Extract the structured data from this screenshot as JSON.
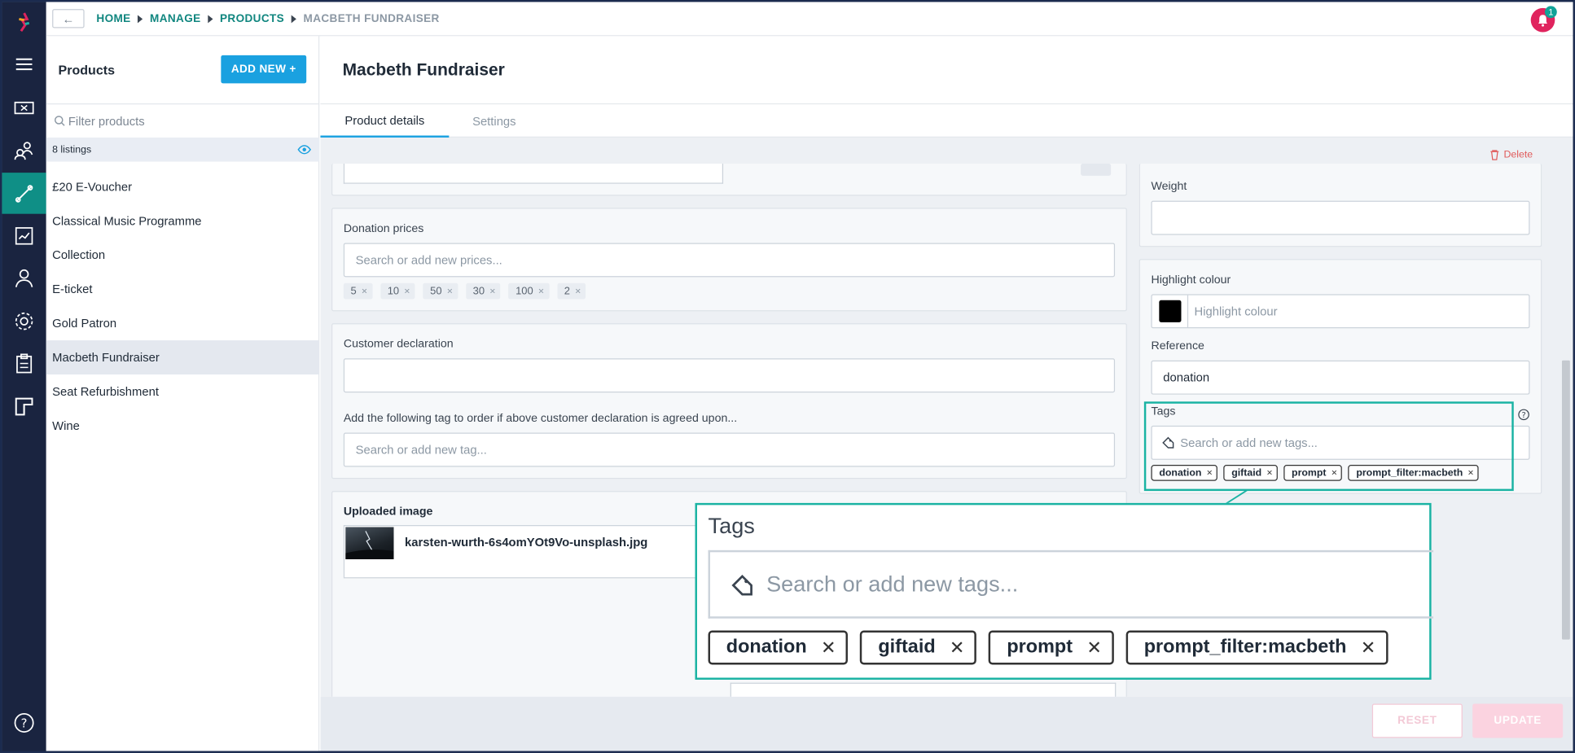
{
  "breadcrumb": [
    "HOME",
    "MANAGE",
    "PRODUCTS",
    "MACBETH FUNDRAISER"
  ],
  "notifications": {
    "count": "1"
  },
  "sidebar": {
    "title": "Products",
    "add_button": "ADD NEW +",
    "filter_placeholder": "Filter products",
    "listings": "8 listings",
    "items": [
      "£20 E-Voucher",
      "Classical Music Programme",
      "Collection",
      "E-ticket",
      "Gold Patron",
      "Macbeth Fundraiser",
      "Seat Refurbishment",
      "Wine"
    ],
    "selected": "Macbeth Fundraiser"
  },
  "main": {
    "title": "Macbeth Fundraiser",
    "tabs": [
      "Product details",
      "Settings"
    ],
    "delete_label": "Delete"
  },
  "form": {
    "donation_prices": {
      "label": "Donation prices",
      "placeholder": "Search or add new prices...",
      "chips": [
        "5",
        "10",
        "50",
        "30",
        "100",
        "2"
      ]
    },
    "customer_declaration": {
      "label": "Customer declaration",
      "tag_label": "Add the following tag to order if above customer declaration is agreed upon...",
      "tag_placeholder": "Search or add new tag..."
    },
    "uploaded_image": {
      "label": "Uploaded image",
      "filename": "karsten-wurth-6s4omYOt9Vo-unsplash.jpg"
    },
    "weight": {
      "label": "Weight",
      "value": ""
    },
    "highlight_colour": {
      "label": "Highlight colour",
      "placeholder": "Highlight colour",
      "swatch": "#000000"
    },
    "reference": {
      "label": "Reference",
      "value": "donation"
    },
    "tags": {
      "label": "Tags",
      "placeholder": "Search or add new tags...",
      "chips": [
        "donation",
        "giftaid",
        "prompt",
        "prompt_filter:macbeth"
      ]
    }
  },
  "footer": {
    "reset": "RESET",
    "update": "UPDATE"
  },
  "colors": {
    "accent": "#0f8f86",
    "primary_button": "#1aa1e0",
    "rail": "#1a2440",
    "highlight": "#1ab3a3",
    "danger": "#e05a5a"
  }
}
